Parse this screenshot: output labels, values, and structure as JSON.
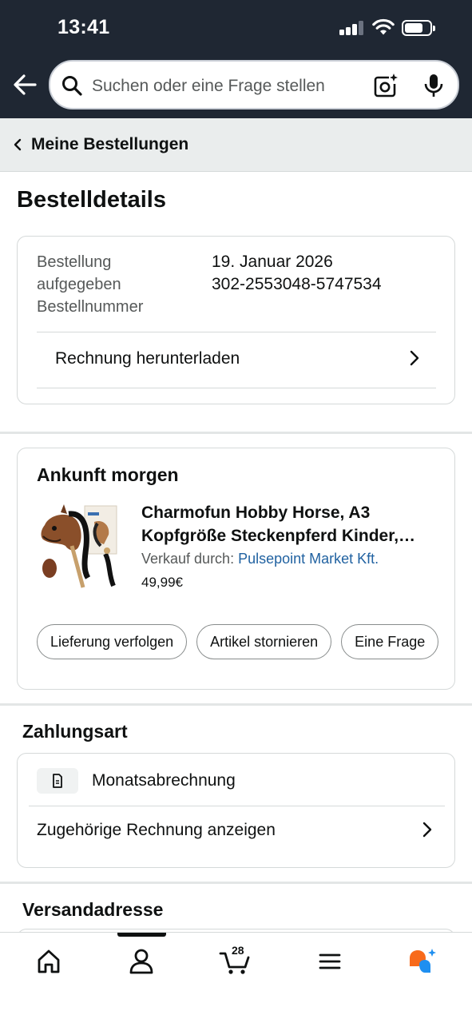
{
  "status_bar": {
    "time": "13:41"
  },
  "search": {
    "placeholder": "Suchen oder eine Frage stellen"
  },
  "breadcrumb": {
    "label": "Meine Bestellungen"
  },
  "page_title": "Bestelldetails",
  "order": {
    "placed_label": "Bestellung aufgegeben",
    "placed_label_line1": "Bestellung",
    "placed_label_line2": "aufgegeben",
    "placed_value": "19. Januar 2026",
    "number_label": "Bestellnummer",
    "number_value": "302-2553048-5747534",
    "invoice_link": "Rechnung herunterladen"
  },
  "delivery": {
    "title": "Ankunft morgen",
    "product": {
      "title_line1": "Charmofun Hobby Horse, A3",
      "title_line2": "Kopfgröße Steckenpferd Kinder,…",
      "seller_prefix": "Verkauf durch:",
      "seller_name": "Pulsepoint Market Kft.",
      "price": "49,99€"
    },
    "actions": [
      "Lieferung verfolgen",
      "Artikel stornieren",
      "Eine Frage"
    ]
  },
  "payment": {
    "title": "Zahlungsart",
    "method": "Monatsabrechnung",
    "method_icon": "document-icon",
    "invoice_link": "Zugehörige Rechnung anzeigen"
  },
  "shipping": {
    "title": "Versandadresse"
  },
  "bottom_nav": {
    "items": [
      "home-icon",
      "account-icon",
      "cart-icon",
      "menu-icon",
      "rufus-assistant-icon"
    ],
    "cart_count": "28",
    "active": "account-icon"
  },
  "colors": {
    "header_bg": "#1f2733",
    "link": "#2162a1",
    "assistant_orange": "#f86a1a",
    "assistant_blue": "#1f8ff0"
  }
}
